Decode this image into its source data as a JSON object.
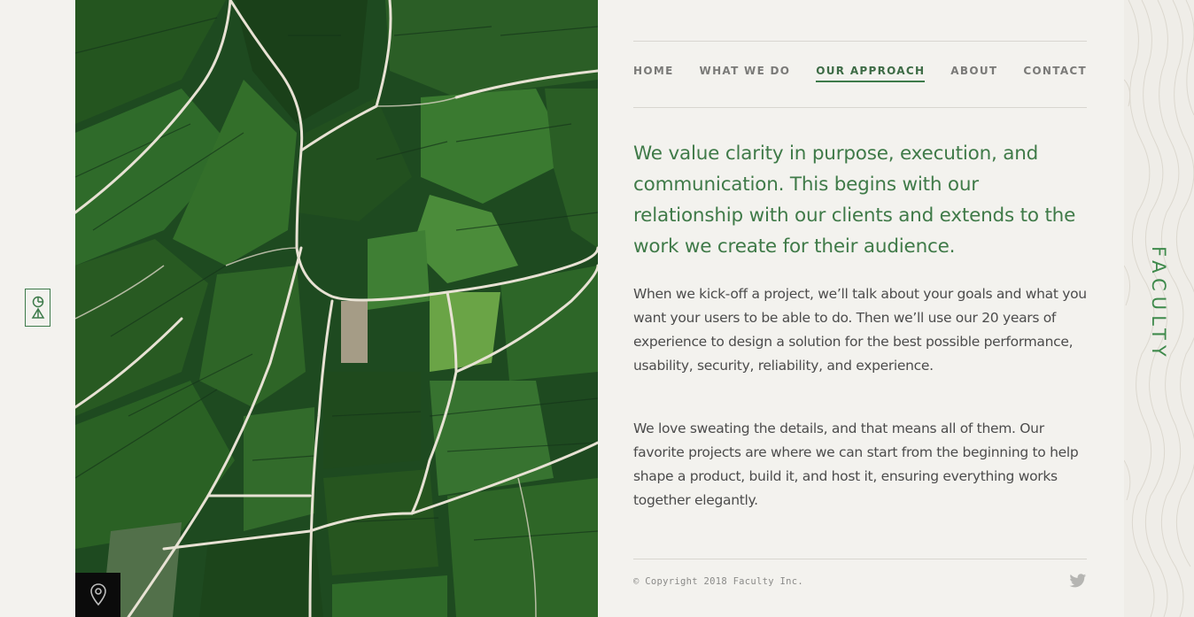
{
  "brand": {
    "name": "FACULTY",
    "logo_icon": "faculty-logo-icon"
  },
  "nav": {
    "items": [
      {
        "label": "HOME",
        "active": false
      },
      {
        "label": "WHAT WE DO",
        "active": false
      },
      {
        "label": "OUR APPROACH",
        "active": true
      },
      {
        "label": "ABOUT",
        "active": false
      },
      {
        "label": "CONTACT",
        "active": false
      }
    ]
  },
  "main": {
    "lead": "We value clarity in purpose, execution, and communication. This begins with our relationship with our clients and extends to the work we create for their audience.",
    "paragraphs": [
      "When we kick-off a project, we’ll talk about your goals and what you want your users to be able to do. Then we’ll use our 20 years of experience to design a solution for the best possible performance, usability, security, reliability, and experience.",
      "We love sweating the details, and that means all of them. Our favorite projects are where we can start from the beginning to help shape a product, build it, and host it, ensuring everything works together elegantly."
    ]
  },
  "footer": {
    "copyright": "© Copyright 2018 Faculty Inc.",
    "social_icon": "twitter-icon"
  },
  "icons": {
    "location": "location-pin-icon"
  },
  "colors": {
    "accent": "#3f7a48",
    "background": "#f3f2ee",
    "text": "#4c4c4c",
    "nav": "#7a7a78"
  }
}
